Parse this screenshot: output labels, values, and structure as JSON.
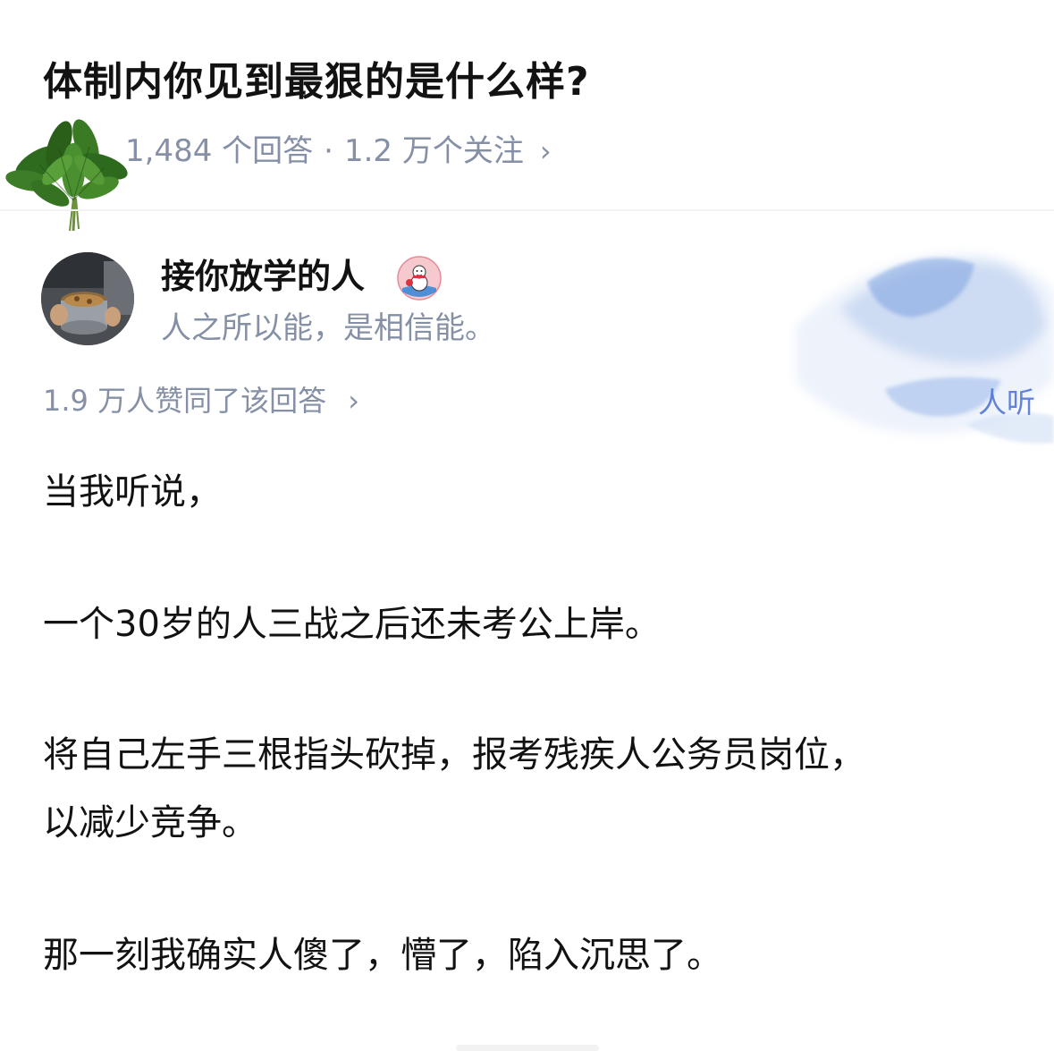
{
  "question": {
    "title": "体制内你见到最狠的是什么样?",
    "answer_count": "1,484 个回答",
    "separator": "·",
    "follow_count": "1.2 万个关注",
    "chevron": "›"
  },
  "author": {
    "name": "接你放学的人",
    "bio": "人之所以能，是相信能。",
    "badge_icon": "snowman-badge-icon",
    "avatar_icon": "avatar-photo-icon"
  },
  "overlay": {
    "brush_text": "人听",
    "brush_color": "#4a6fd3"
  },
  "vote": {
    "text": "1.9 万人赞同了该回答",
    "chevron": "›"
  },
  "answer": {
    "paragraphs": [
      "当我听说，",
      "一个30岁的人三战之后还未考公上岸。",
      "将自己左手三根指头砍掉，报考残疾人公务员岗位，",
      "以减少竞争。",
      "那一刻我确实人傻了，懵了，陷入沉思了。"
    ]
  },
  "colors": {
    "text": "#121212",
    "meta": "#8590a6",
    "divider": "#f0f2f5"
  }
}
